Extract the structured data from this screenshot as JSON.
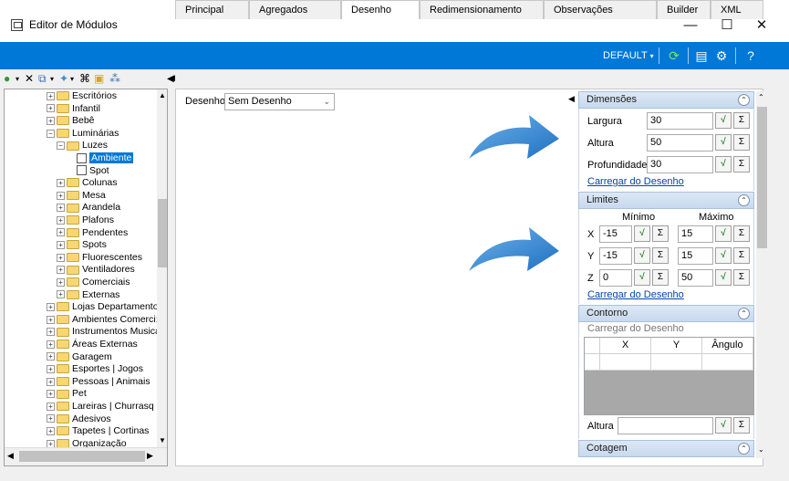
{
  "window": {
    "title": "Editor de Módulos",
    "minimize": "—",
    "maximize": "☐",
    "close": "✕"
  },
  "toolbar": {
    "profile": "DEFAULT",
    "icons": [
      "refresh-icon",
      "layout-icon",
      "settings-icon",
      "help-icon"
    ]
  },
  "tree": {
    "items": [
      {
        "label": "Escritórios",
        "indent": 2,
        "expander": "+",
        "icon": "folder"
      },
      {
        "label": "Infantil",
        "indent": 2,
        "expander": "+",
        "icon": "folder"
      },
      {
        "label": "Bebê",
        "indent": 2,
        "expander": "+",
        "icon": "folder"
      },
      {
        "label": "Luminárias",
        "indent": 2,
        "expander": "−",
        "icon": "folder"
      },
      {
        "label": "Luzes",
        "indent": 3,
        "expander": "−",
        "icon": "folder"
      },
      {
        "label": "Ambiente",
        "indent": 4,
        "expander": "",
        "icon": "doc",
        "selected": true
      },
      {
        "label": "Spot",
        "indent": 4,
        "expander": "",
        "icon": "doc"
      },
      {
        "label": "Colunas",
        "indent": 3,
        "expander": "+",
        "icon": "folder"
      },
      {
        "label": "Mesa",
        "indent": 3,
        "expander": "+",
        "icon": "folder"
      },
      {
        "label": "Arandela",
        "indent": 3,
        "expander": "+",
        "icon": "folder"
      },
      {
        "label": "Plafons",
        "indent": 3,
        "expander": "+",
        "icon": "folder"
      },
      {
        "label": "Pendentes",
        "indent": 3,
        "expander": "+",
        "icon": "folder"
      },
      {
        "label": "Spots",
        "indent": 3,
        "expander": "+",
        "icon": "folder"
      },
      {
        "label": "Fluorescentes",
        "indent": 3,
        "expander": "+",
        "icon": "folder"
      },
      {
        "label": "Ventiladores",
        "indent": 3,
        "expander": "+",
        "icon": "folder"
      },
      {
        "label": "Comerciais",
        "indent": 3,
        "expander": "+",
        "icon": "folder"
      },
      {
        "label": "Externas",
        "indent": 3,
        "expander": "+",
        "icon": "folder"
      },
      {
        "label": "Lojas Departamento",
        "indent": 2,
        "expander": "+",
        "icon": "folder"
      },
      {
        "label": "Ambientes Comerci:",
        "indent": 2,
        "expander": "+",
        "icon": "folder"
      },
      {
        "label": "Instrumentos Musica",
        "indent": 2,
        "expander": "+",
        "icon": "folder"
      },
      {
        "label": "Áreas Externas",
        "indent": 2,
        "expander": "+",
        "icon": "folder"
      },
      {
        "label": "Garagem",
        "indent": 2,
        "expander": "+",
        "icon": "folder"
      },
      {
        "label": "Esportes | Jogos",
        "indent": 2,
        "expander": "+",
        "icon": "folder"
      },
      {
        "label": "Pessoas | Animais",
        "indent": 2,
        "expander": "+",
        "icon": "folder"
      },
      {
        "label": "Pet",
        "indent": 2,
        "expander": "+",
        "icon": "folder"
      },
      {
        "label": "Lareiras | Churrasq",
        "indent": 2,
        "expander": "+",
        "icon": "folder"
      },
      {
        "label": "Adesivos",
        "indent": 2,
        "expander": "+",
        "icon": "folder"
      },
      {
        "label": "Tapetes | Cortinas",
        "indent": 2,
        "expander": "+",
        "icon": "folder"
      },
      {
        "label": "Organização",
        "indent": 2,
        "expander": "+",
        "icon": "folder"
      }
    ]
  },
  "tabs": [
    "Principal",
    "Agregados",
    "Desenho",
    "Redimensionamento",
    "Observações",
    "Builder",
    "XML"
  ],
  "active_tab": "Desenho",
  "desenho": {
    "label": "Desenho",
    "value": "Sem Desenho"
  },
  "dimensoes": {
    "title": "Dimensões",
    "largura_label": "Largura",
    "largura": "30",
    "altura_label": "Altura",
    "altura": "50",
    "profundidade_label": "Profundidade",
    "profundidade": "30",
    "link": "Carregar do Desenho"
  },
  "limites": {
    "title": "Limites",
    "min_label": "Mínimo",
    "max_label": "Máximo",
    "rows": [
      {
        "axis": "X",
        "min": "-15",
        "max": "15"
      },
      {
        "axis": "Y",
        "min": "-15",
        "max": "15"
      },
      {
        "axis": "Z",
        "min": "0",
        "max": "50"
      }
    ],
    "link": "Carregar do Desenho"
  },
  "contorno": {
    "title": "Contorno",
    "link": "Carregar do Desenho",
    "columns": [
      "X",
      "Y",
      "Ângulo"
    ],
    "altura_label": "Altura",
    "altura": ""
  },
  "cotagem": {
    "title": "Cotagem"
  },
  "buttons": {
    "sqrt": "√",
    "sigma": "Σ",
    "collapse": "⌃"
  }
}
